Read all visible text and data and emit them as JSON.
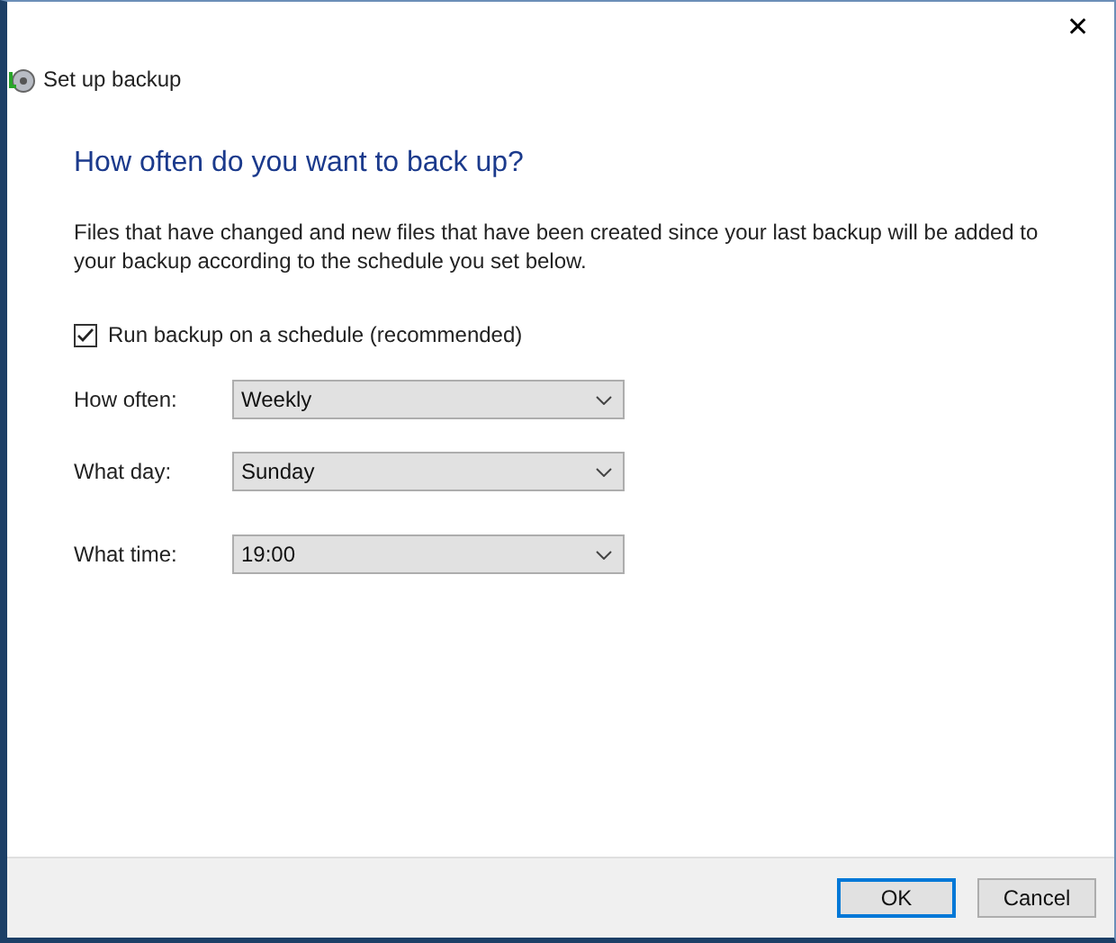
{
  "window": {
    "title": "Set up backup",
    "close": "✕"
  },
  "heading": "How often do you want to back up?",
  "description": "Files that have changed and new files that have been created since your last backup will be added to your backup according to the schedule you set below.",
  "schedule_checkbox": {
    "label": "Run backup on a schedule (recommended)",
    "checked": true
  },
  "fields": [
    {
      "label": "How often:",
      "value": "Weekly"
    },
    {
      "label": "What day:",
      "value": "Sunday"
    },
    {
      "label": "What time:",
      "value": "19:00"
    }
  ],
  "buttons": [
    {
      "label": "OK",
      "default": true
    },
    {
      "label": "Cancel",
      "default": false
    }
  ]
}
